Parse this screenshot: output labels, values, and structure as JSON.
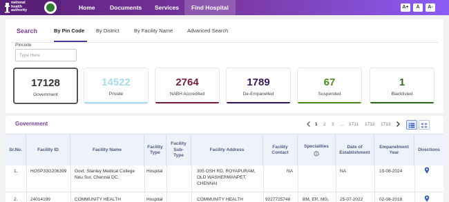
{
  "header": {
    "org_name": "national health authority",
    "nav": [
      "Home",
      "Documents",
      "Services",
      "Find Hospital"
    ],
    "font_size_buttons": [
      "A+",
      "A",
      "A-"
    ],
    "gradient": [
      "#5b1f7a",
      "#8b5cf6"
    ]
  },
  "search": {
    "title": "Search",
    "tabs": [
      "By Pin Code",
      "By District",
      "By Facility Name",
      "Advanced Search"
    ],
    "pincode_label": "Pincode",
    "pincode_placeholder": "Type Here",
    "pincode_value": ""
  },
  "stats": [
    {
      "value": "17128",
      "label": "Government",
      "color": "#333333"
    },
    {
      "value": "14522",
      "label": "Private",
      "color": "#9fd6e6"
    },
    {
      "value": "2764",
      "label": "NABH Accredited",
      "color": "#7a1f3a"
    },
    {
      "value": "1789",
      "label": "De-Empanelled",
      "color": "#3b1a5a"
    },
    {
      "value": "67",
      "label": "Suspended",
      "color": "#4f8a1f"
    },
    {
      "value": "1",
      "label": "Blacklisted",
      "color": "#2f6a1f"
    }
  ],
  "table": {
    "title": "Government",
    "pagination": [
      "1",
      "2",
      "3",
      "...",
      "1711",
      "1712",
      "1713"
    ],
    "columns": [
      "Sr.No.",
      "Facility ID",
      "Facility Name",
      "Facility Type",
      "Facility Sub-Type",
      "Facility Address",
      "Facility Contact",
      "Specialities",
      "Date of Establishment",
      "Empanelment Year",
      "Directions"
    ],
    "rows": [
      {
        "sr": "1.",
        "id": "HOSP33G206399",
        "name": "Govt. Stanley Medical College Neu Sur, Chennai DC.",
        "type": "Hospital",
        "subtype": "",
        "address": "305 OSH RD, ROYAPURAM, OLD WASHERMANPET, CHENNAI",
        "contact": "NA",
        "specialities": "",
        "established": "NA",
        "empanelment": "10-08-2024"
      },
      {
        "sr": "2.",
        "id": "24014199",
        "name": "COMMUNITY HEALTH",
        "type": "Hospital",
        "subtype": "",
        "address": "COMMUNITY HEALTH",
        "contact": "9227725748",
        "specialities": "BM, ER, MG,",
        "established": "25-07-2022",
        "empanelment": "02-08-2018"
      }
    ]
  }
}
